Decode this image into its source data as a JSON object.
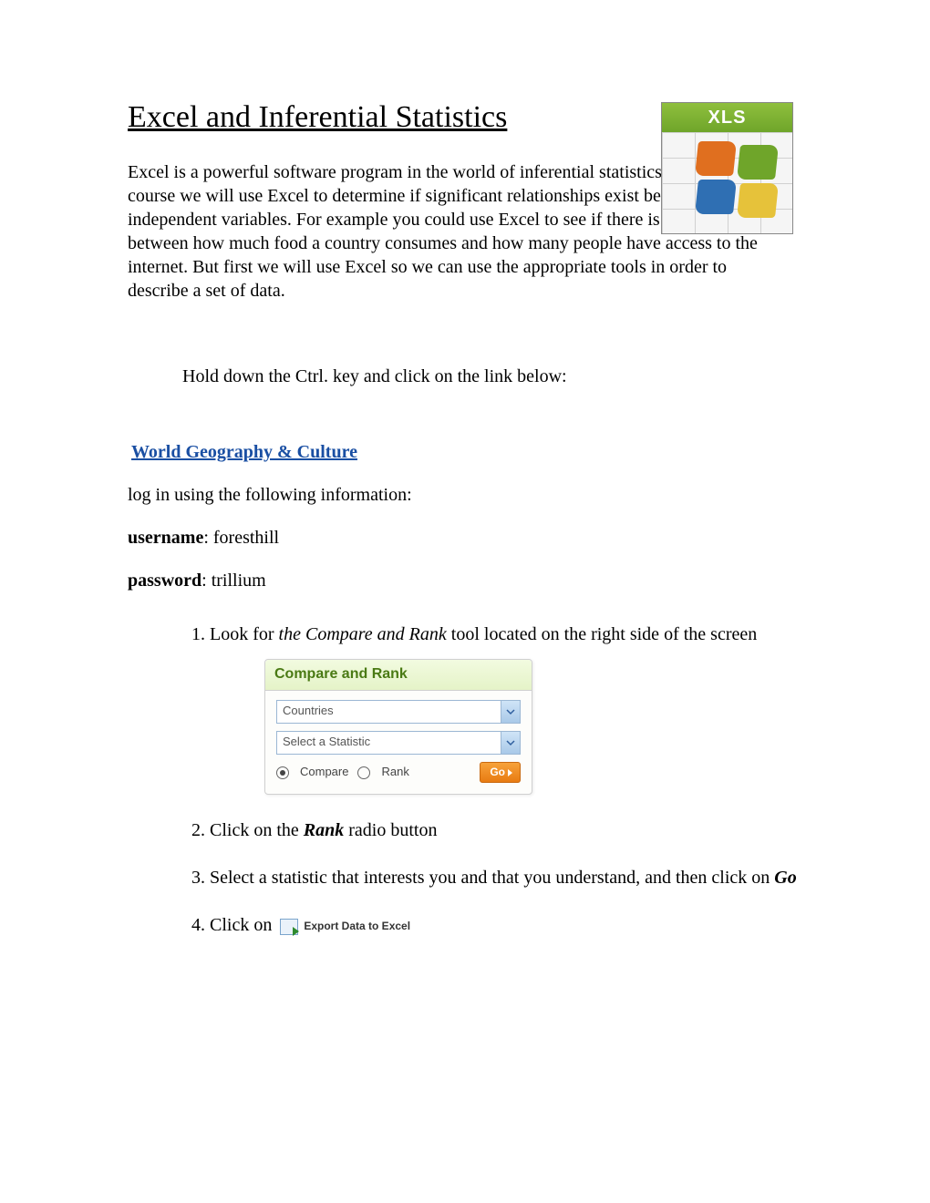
{
  "title": "Excel and Inferential Statistics",
  "xls_label": "XLS",
  "intro": "Excel is a powerful software program in the world of inferential statistics.  Later in the course we will use Excel to determine if significant relationships exist between two independent variables. For example you could use Excel to see if there is a relationship between how much food a country consumes and how many people have access to the internet. But first we will use Excel so we can use the appropriate tools in order to describe a set of data.",
  "ctrl_note": "Hold down the Ctrl. key and click on the link below:",
  "link_text": "World Geography & Culture ",
  "login_intro": "log in using the following information:",
  "cred": {
    "user_label": "username",
    "user_value": ": foresthill",
    "pass_label": "password",
    "pass_value": ": trillium"
  },
  "steps": {
    "s1a": "Look for ",
    "s1b": "the Compare and Rank",
    "s1c": " tool located on the right side of the screen",
    "s2a": "Click on the ",
    "s2b": "Rank",
    "s2c": " radio button",
    "s3a": "Select a statistic that interests you and that you understand, and then click on ",
    "s3b": "Go",
    "s4a": "Click on "
  },
  "cr": {
    "title": "Compare and Rank",
    "select1": "Countries",
    "select2": "Select a Statistic",
    "radio_compare": "Compare",
    "radio_rank": "Rank",
    "go": "Go"
  },
  "export_label": "Export Data to Excel"
}
